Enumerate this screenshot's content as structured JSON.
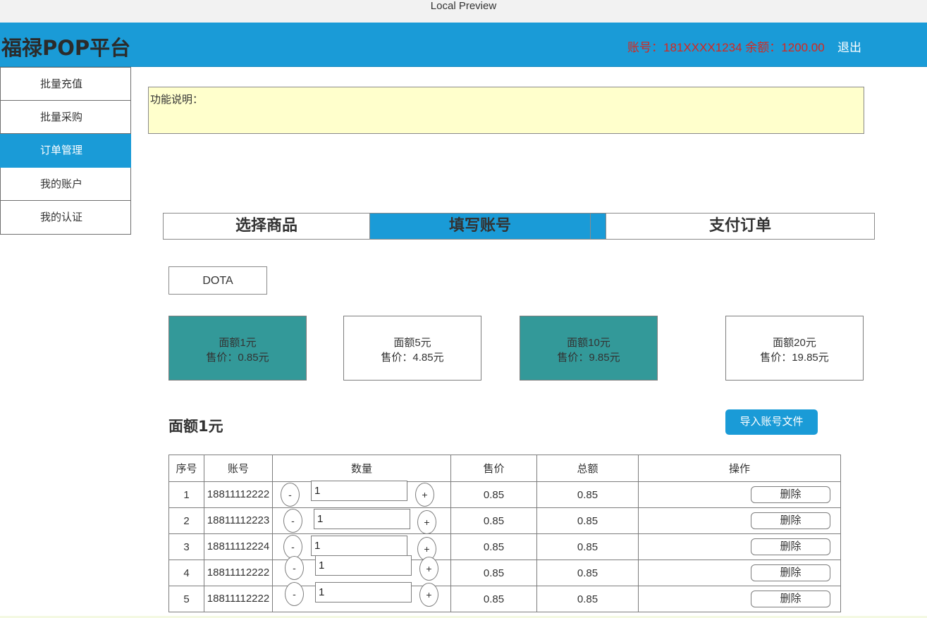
{
  "window": {
    "title": "Local Preview"
  },
  "header": {
    "brand": "福禄POP平台",
    "account_text": "账号：181XXXX1234 余额：1200.00",
    "logout": "退出"
  },
  "sidebar": {
    "items": [
      {
        "label": "批量充值"
      },
      {
        "label": "批量采购"
      },
      {
        "label": "订单管理",
        "active": true
      },
      {
        "label": "我的账户"
      },
      {
        "label": "我的认证"
      }
    ]
  },
  "description": {
    "label": "功能说明："
  },
  "steps": [
    {
      "label": "选择商品"
    },
    {
      "label": "填写账号"
    },
    {
      "label": "支付订单"
    }
  ],
  "game_tab": {
    "label": "DOTA"
  },
  "cards": [
    {
      "face": "面额1元",
      "price": "售价：0.85元",
      "selected": true
    },
    {
      "face": "面额5元",
      "price": "售价：4.85元",
      "selected": false
    },
    {
      "face": "面额10元",
      "price": "售价：9.85元",
      "selected": true
    },
    {
      "face": "面额20元",
      "price": "售价：19.85元",
      "selected": false
    }
  ],
  "section": {
    "title": "面额1元",
    "import_button": "导入账号文件"
  },
  "table": {
    "headers": [
      "序号",
      "账号",
      "数量",
      "售价",
      "总额",
      "操作"
    ],
    "minus": "-",
    "plus": "+",
    "delete_label": "删除",
    "rows": [
      {
        "index": "1",
        "account": "18811112222",
        "qty": "1",
        "price": "0.85",
        "total": "0.85"
      },
      {
        "index": "2",
        "account": "18811112223",
        "qty": "1",
        "price": "0.85",
        "total": "0.85"
      },
      {
        "index": "3",
        "account": "18811112224",
        "qty": "1",
        "price": "0.85",
        "total": "0.85"
      },
      {
        "index": "4",
        "account": "18811112222",
        "qty": "1",
        "price": "0.85",
        "total": "0.85"
      },
      {
        "index": "5",
        "account": "18811112222",
        "qty": "1",
        "price": "0.85",
        "total": "0.85"
      }
    ]
  },
  "colors": {
    "accent": "#1a9bd7",
    "selected_card": "#339999",
    "description_bg": "#ffffcc",
    "account_text": "#d9261c"
  }
}
